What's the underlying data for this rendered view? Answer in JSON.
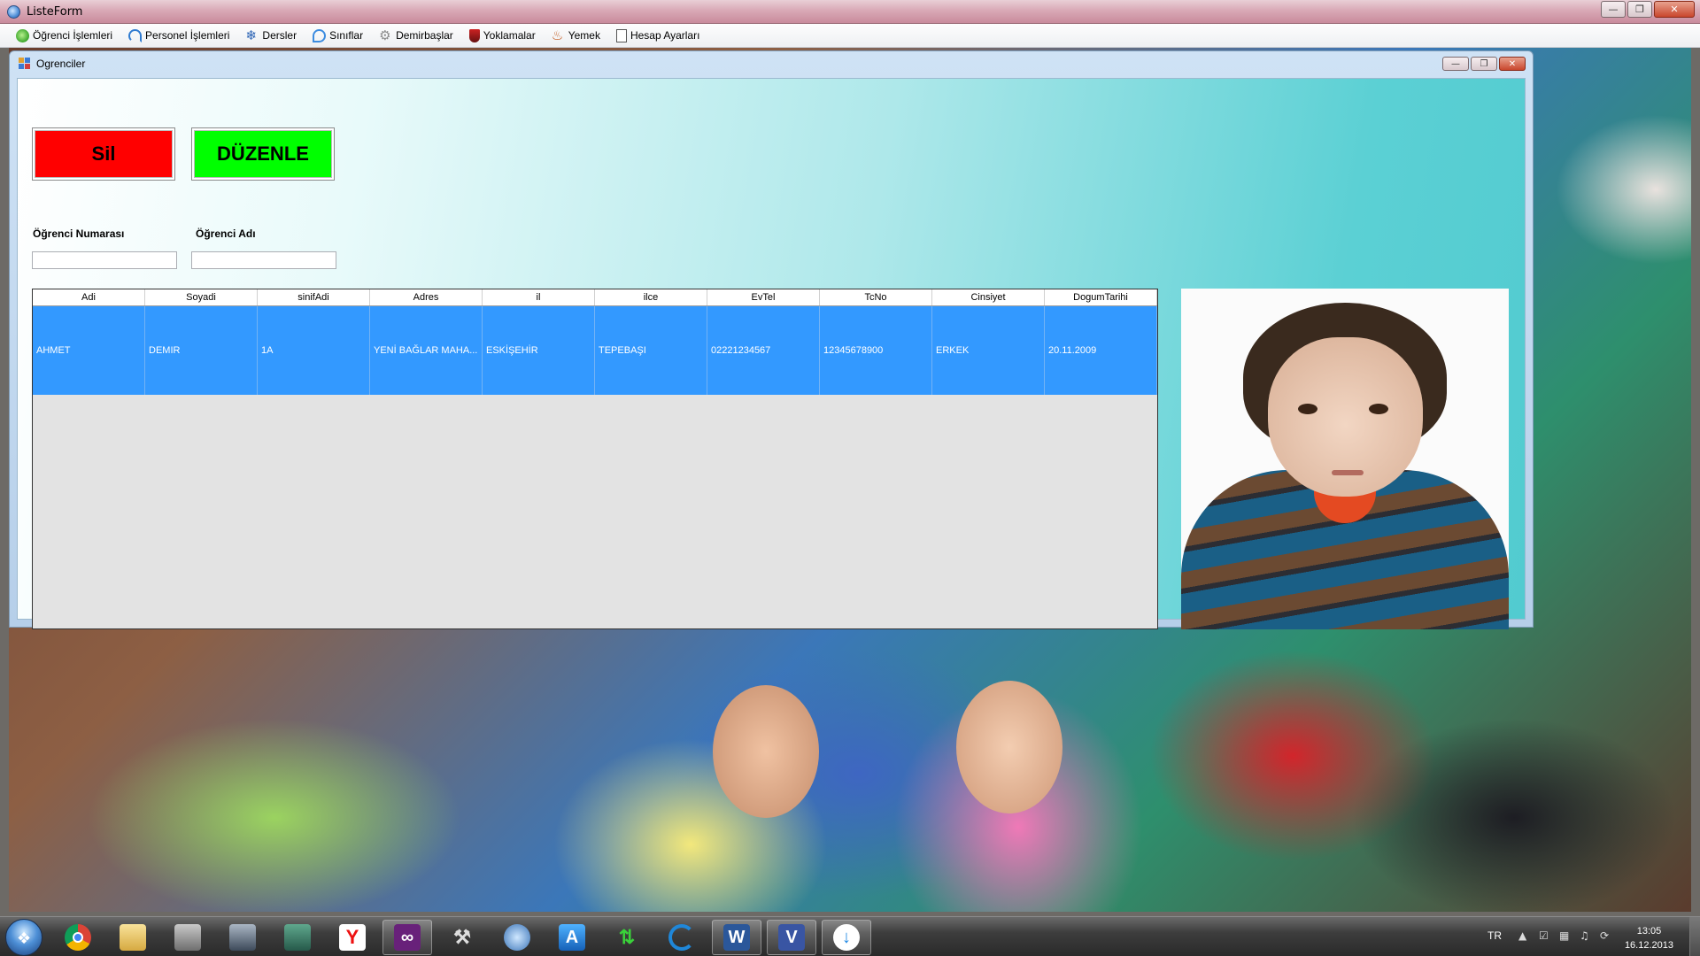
{
  "window": {
    "title": "ListeForm"
  },
  "menu": [
    {
      "label": "Öğrenci İşlemleri",
      "icon": "check-icon"
    },
    {
      "label": "Personel İşlemleri",
      "icon": "refresh-arrow-icon"
    },
    {
      "label": "Dersler",
      "icon": "snowflake-icon"
    },
    {
      "label": "Sınıflar",
      "icon": "ring-icon"
    },
    {
      "label": "Demirbaşlar",
      "icon": "gear-icon"
    },
    {
      "label": "Yoklamalar",
      "icon": "shield-icon"
    },
    {
      "label": "Yemek",
      "icon": "food-icon"
    },
    {
      "label": "Hesap Ayarları",
      "icon": "document-icon"
    }
  ],
  "child": {
    "title": "Ogrenciler",
    "buttons": {
      "delete": "Sil",
      "edit": "DÜZENLE"
    },
    "fields": {
      "student_number_label": "Öğrenci Numarası",
      "student_number_value": "",
      "student_name_label": "Öğrenci Adı",
      "student_name_value": ""
    },
    "grid": {
      "columns": [
        "Adi",
        "Soyadi",
        "sinifAdi",
        "Adres",
        "il",
        "ilce",
        "EvTel",
        "TcNo",
        "Cinsiyet",
        "DogumTarihi"
      ],
      "rows": [
        [
          "AHMET",
          "DEMIR",
          "1A",
          "YENİ BAĞLAR MAHA...",
          "ESKİŞEHİR",
          "TEPEBAŞI",
          "02221234567",
          "12345678900",
          "ERKEK",
          "20.11.2009"
        ]
      ],
      "selected_color": "#3399ff"
    }
  },
  "colors": {
    "delete_button": "#ff0000",
    "edit_button": "#00ff00"
  },
  "taskbar": {
    "apps": [
      "chrome-icon",
      "explorer-icon",
      "db-tools-icon",
      "media-icon",
      "app-icon",
      "yandex-icon",
      "visual-studio-icon",
      "tools-icon",
      "blank-app-icon",
      "navigation-icon",
      "transfer-icon",
      "ccleaner-icon",
      "word-icon",
      "visio-icon",
      "download-icon"
    ],
    "language": "TR",
    "time": "13:05",
    "date": "16.12.2013"
  }
}
